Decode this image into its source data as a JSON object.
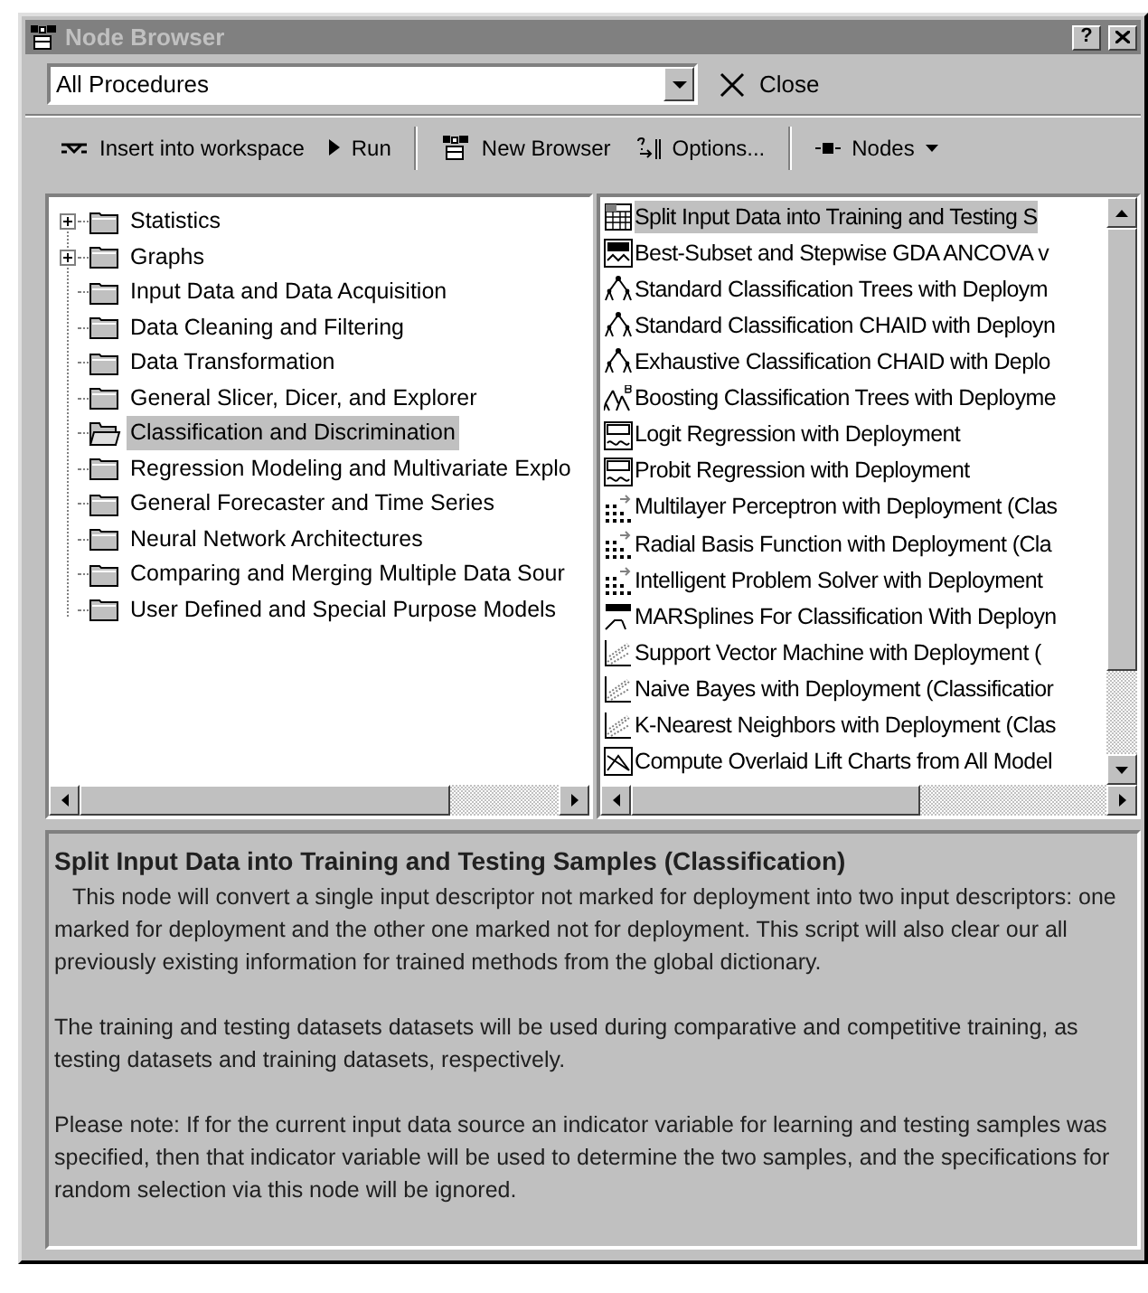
{
  "window": {
    "title": "Node Browser",
    "help_button": "?"
  },
  "filter": {
    "value": "All Procedures"
  },
  "close_button": {
    "label": "Close"
  },
  "toolbar": [
    {
      "kind": "insert",
      "label": "Insert into workspace"
    },
    {
      "kind": "run",
      "label": "Run"
    },
    {
      "kind": "separator"
    },
    {
      "kind": "browser",
      "label": "New Browser"
    },
    {
      "kind": "options",
      "label": "Options..."
    },
    {
      "kind": "separator"
    },
    {
      "kind": "nodes",
      "label": "Nodes"
    }
  ],
  "tree": [
    {
      "label": "Statistics",
      "expandable": true,
      "selected": false
    },
    {
      "label": "Graphs",
      "expandable": true,
      "selected": false
    },
    {
      "label": "Input Data and Data Acquisition",
      "expandable": false,
      "selected": false
    },
    {
      "label": "Data Cleaning and Filtering",
      "expandable": false,
      "selected": false
    },
    {
      "label": "Data Transformation",
      "expandable": false,
      "selected": false
    },
    {
      "label": "General Slicer, Dicer, and Explorer",
      "expandable": false,
      "selected": false
    },
    {
      "label": "Classification and Discrimination",
      "expandable": false,
      "selected": true
    },
    {
      "label": "Regression Modeling and Multivariate Explo",
      "expandable": false,
      "selected": false
    },
    {
      "label": "General Forecaster and Time Series",
      "expandable": false,
      "selected": false
    },
    {
      "label": "Neural Network Architectures",
      "expandable": false,
      "selected": false
    },
    {
      "label": "Comparing and Merging Multiple Data Sour",
      "expandable": false,
      "selected": false
    },
    {
      "label": "User Defined and Special Purpose Models",
      "expandable": false,
      "selected": false
    }
  ],
  "nodes": [
    {
      "kind": "table",
      "label": "Split Input Data into Training and Testing S",
      "selected": true
    },
    {
      "kind": "gda",
      "label": "Best-Subset and Stepwise GDA ANCOVA v",
      "selected": false
    },
    {
      "kind": "tree",
      "label": "Standard Classification Trees with Deploym",
      "selected": false
    },
    {
      "kind": "tree",
      "label": "Standard Classification CHAID with Deployn",
      "selected": false
    },
    {
      "kind": "tree",
      "label": "Exhaustive Classification CHAID with Deplo",
      "selected": false
    },
    {
      "kind": "boosting",
      "label": "Boosting Classification Trees with Deployme",
      "selected": false
    },
    {
      "kind": "glz",
      "label": "Logit Regression with Deployment",
      "selected": false
    },
    {
      "kind": "glz",
      "label": "Probit Regression with Deployment",
      "selected": false
    },
    {
      "kind": "neural",
      "label": "Multilayer Perceptron with Deployment (Clas",
      "selected": false
    },
    {
      "kind": "neural",
      "label": "Radial Basis Function with Deployment (Cla",
      "selected": false
    },
    {
      "kind": "neural",
      "label": "Intelligent Problem Solver with Deployment",
      "selected": false
    },
    {
      "kind": "mars",
      "label": "MARSplines For Classification With Deployn",
      "selected": false
    },
    {
      "kind": "scatter",
      "label": "Support Vector Machine with Deployment (",
      "selected": false
    },
    {
      "kind": "scatter",
      "label": "Naive Bayes with Deployment (Classificatior",
      "selected": false
    },
    {
      "kind": "scatter",
      "label": "K-Nearest Neighbors with Deployment (Clas",
      "selected": false
    },
    {
      "kind": "lift",
      "label": "Compute Overlaid Lift Charts from All Model",
      "selected": false
    }
  ],
  "description": {
    "title": "Split Input Data into Training and Testing Samples (Classification)",
    "paragraphs": [
      "This node will convert a single input descriptor not marked for deployment into two input descriptors: one marked for deployment and the other one marked not for deployment. This script will also clear our all previously existing information for trained methods from the global dictionary.",
      "The training and testing datasets datasets will be used during comparative and competitive training, as testing datasets and training datasets, respectively.",
      "Please note: If for the current input data source an indicator variable for learning and testing samples was specified, then that indicator variable will be used to determine the two samples, and the specifications for random selection via this node will be ignored."
    ]
  }
}
